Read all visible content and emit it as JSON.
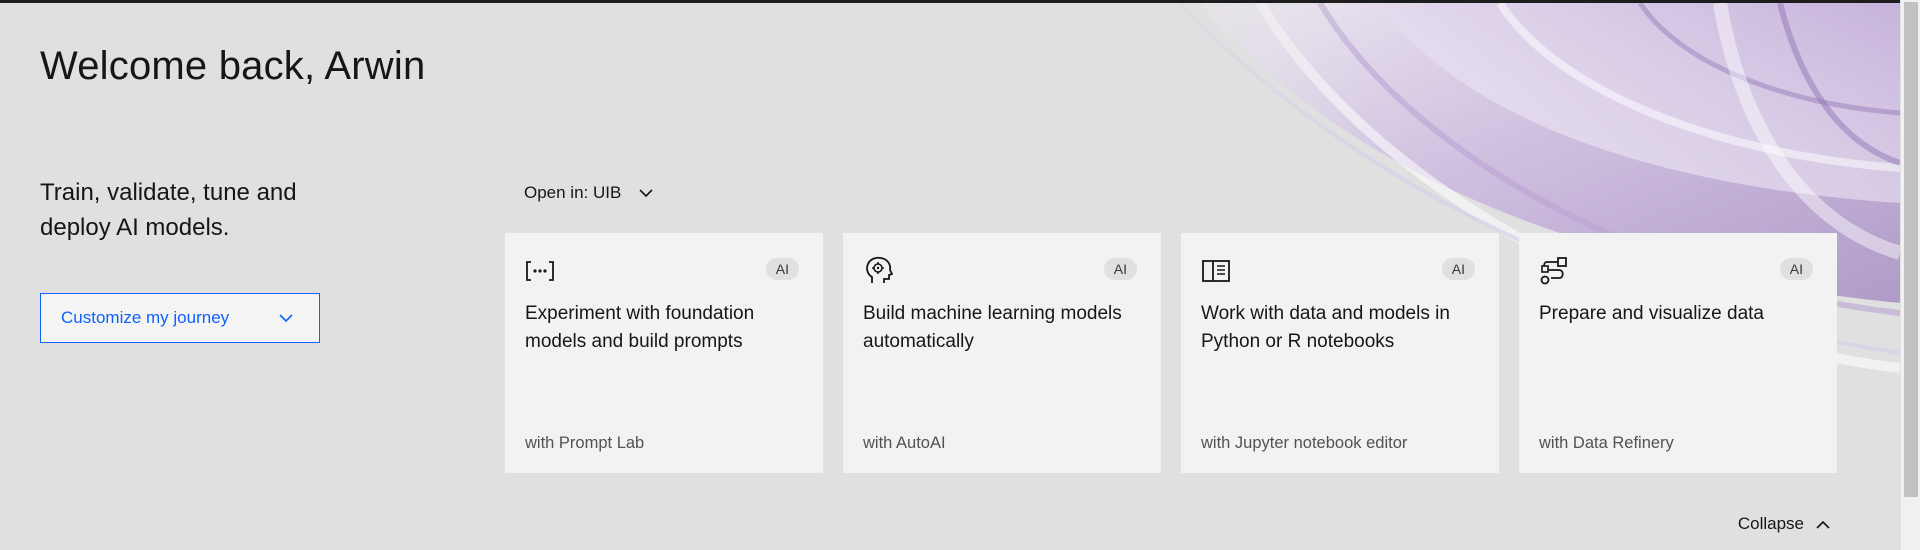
{
  "header": {
    "welcome": "Welcome back, Arwin"
  },
  "intro": {
    "tagline": "Train, validate, tune and deploy AI models.",
    "journey_button": "Customize my journey"
  },
  "open_in": {
    "label": "Open in: UIB"
  },
  "cards": [
    {
      "icon": "prompt-brackets-icon",
      "badge": "AI",
      "title": "Experiment with foundation models and build prompts",
      "subtitle": "with Prompt Lab"
    },
    {
      "icon": "machine-learning-head-icon",
      "badge": "AI",
      "title": "Build machine learning models automatically",
      "subtitle": "with AutoAI"
    },
    {
      "icon": "notebook-icon",
      "badge": "AI",
      "title": "Work with data and models in Python or R notebooks",
      "subtitle": "with Jupyter notebook editor"
    },
    {
      "icon": "data-refinery-icon",
      "badge": "AI",
      "title": "Prepare and visualize data",
      "subtitle": "with Data Refinery"
    }
  ],
  "footer": {
    "collapse": "Collapse"
  },
  "colors": {
    "background": "#e0e0e0",
    "card": "#f2f2f2",
    "accent": "#0f62fe",
    "art": "#a78fc4"
  }
}
